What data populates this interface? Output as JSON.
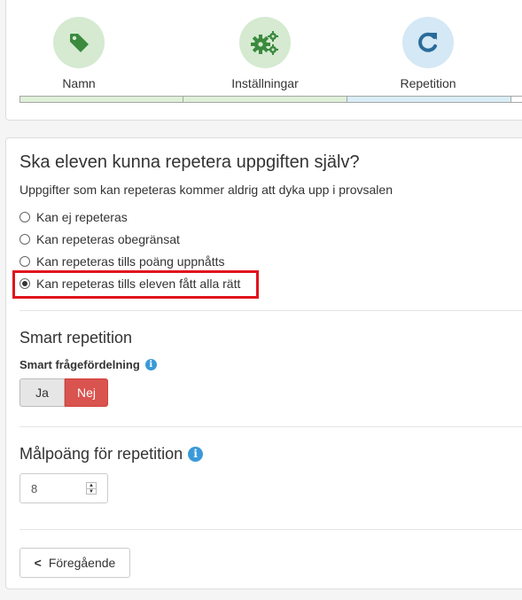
{
  "steps": [
    {
      "label": "Namn",
      "icon": "tag-icon"
    },
    {
      "label": "Inställningar",
      "icon": "gears-icon"
    },
    {
      "label": "Repetition",
      "icon": "redo-icon"
    }
  ],
  "colors": {
    "step_done": "#d5ead1",
    "step_active": "#d4e8f5",
    "icon_green": "#3b8a3e",
    "icon_blue": "#2a6b9a",
    "danger": "#d9534f",
    "highlight": "#e0141e",
    "info": "#3a9ad9"
  },
  "question": {
    "title": "Ska eleven kunna repetera uppgiften själv?",
    "help": "Uppgifter som kan repeteras kommer aldrig att dyka upp i provsalen",
    "options": [
      {
        "label": "Kan ej repeteras",
        "selected": false
      },
      {
        "label": "Kan repeteras obegränsat",
        "selected": false
      },
      {
        "label": "Kan repeteras tills poäng uppnåtts",
        "selected": false
      },
      {
        "label": "Kan repeteras tills eleven fått alla rätt",
        "selected": true
      }
    ]
  },
  "smart": {
    "title": "Smart repetition",
    "label": "Smart frågefördelning",
    "yes": "Ja",
    "no": "Nej",
    "selected": "Nej"
  },
  "target": {
    "title": "Målpoäng för repetition",
    "value": "8"
  },
  "nav": {
    "previous": "Föregående"
  }
}
